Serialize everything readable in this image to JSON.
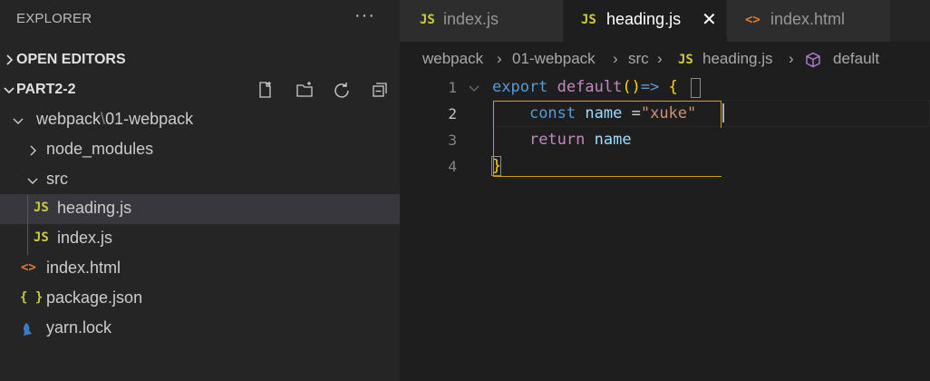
{
  "sidebar": {
    "title": "EXPLORER",
    "more": "···",
    "sections": {
      "open_editors": "OPEN EDITORS",
      "workspace": "PART2-2"
    },
    "tree": {
      "webpack_folder": {
        "part1": "webpack",
        "separator": "\\",
        "part2": "01-webpack"
      },
      "node_modules": "node_modules",
      "src": "src",
      "heading_js": "heading.js",
      "index_js": "index.js",
      "index_html": "index.html",
      "package_json": "package.json",
      "yarn_lock": "yarn.lock"
    },
    "icons": {
      "js": "JS",
      "html": "<>",
      "json": "{ }"
    }
  },
  "tabs": [
    {
      "icon": "JS",
      "label": "index.js"
    },
    {
      "icon": "JS",
      "label": "heading.js",
      "close": "✕"
    },
    {
      "icon": "<>",
      "label": "index.html"
    }
  ],
  "breadcrumb": {
    "p1": "webpack",
    "p2": "01-webpack",
    "p3": "src",
    "p4_icon": "JS",
    "p4": "heading.js",
    "p5": "default",
    "sep": "›"
  },
  "editor": {
    "lines": [
      "1",
      "2",
      "3",
      "4"
    ],
    "code": {
      "l1_export": "export",
      "l1_default": "default",
      "l1_parens": "()",
      "l1_arrow": "=>",
      "l1_brace": "{",
      "l2_const": "const",
      "l2_name": "name",
      "l2_eq": "=",
      "l2_str": "\"xuke\"",
      "l3_return": "return",
      "l3_name": "name",
      "l4_brace": "}"
    }
  },
  "colors": {
    "js_icon": "#cbcb41",
    "html_icon": "#e37933",
    "json_icon": "#cbcb41",
    "yarn_icon": "#3b7bbf",
    "symbol_icon": "#b180d7"
  }
}
